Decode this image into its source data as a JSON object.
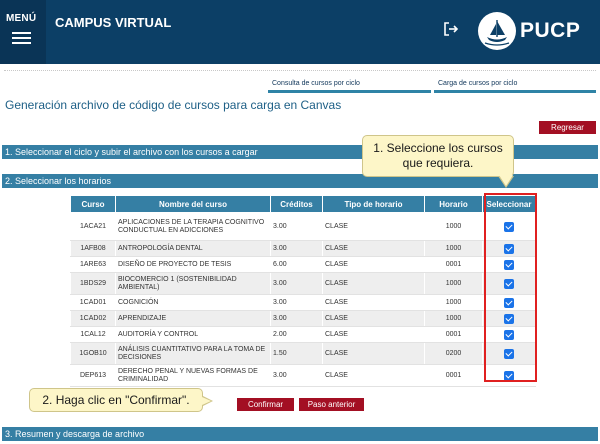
{
  "header": {
    "menu_label": "MENÚ",
    "app_title": "CAMPUS VIRTUAL",
    "logo_text": "PUCP",
    "brand_color": "#0c3f66"
  },
  "nav": {
    "consulta_label": "Consulta de cursos por ciclo",
    "carga_label": "Carga de cursos por ciclo"
  },
  "page": {
    "title": "Generación archivo de código de cursos para carga en Canvas",
    "regresar_label": "Regresar"
  },
  "sections": {
    "step1": "1. Seleccionar el ciclo y subir el archivo con los cursos a cargar",
    "step2": "2. Seleccionar los horarios",
    "step3": "3. Resumen y descarga de archivo"
  },
  "table": {
    "columns": [
      "Curso",
      "Nombre del curso",
      "Créditos",
      "Tipo de horario",
      "Horario",
      "Seleccionar"
    ],
    "rows": [
      {
        "code": "1ACA21",
        "name": "APLICACIONES DE LA TERAPIA COGNITIVO CONDUCTUAL EN ADICCIONES",
        "credits": "3.00",
        "type": "CLASE",
        "schedule": "1000",
        "selected": true
      },
      {
        "code": "1AFB08",
        "name": "ANTROPOLOGÍA DENTAL",
        "credits": "3.00",
        "type": "CLASE",
        "schedule": "1000",
        "selected": true
      },
      {
        "code": "1ARE63",
        "name": "DISEÑO DE PROYECTO DE TESIS",
        "credits": "6.00",
        "type": "CLASE",
        "schedule": "0001",
        "selected": true
      },
      {
        "code": "1BDS29",
        "name": "BIOCOMERCIO 1 (SOSTENIBILIDAD AMBIENTAL)",
        "credits": "3.00",
        "type": "CLASE",
        "schedule": "1000",
        "selected": true
      },
      {
        "code": "1CAD01",
        "name": "COGNICIÓN",
        "credits": "3.00",
        "type": "CLASE",
        "schedule": "1000",
        "selected": true
      },
      {
        "code": "1CAD02",
        "name": "APRENDIZAJE",
        "credits": "3.00",
        "type": "CLASE",
        "schedule": "1000",
        "selected": true
      },
      {
        "code": "1CAL12",
        "name": "AUDITORÍA Y CONTROL",
        "credits": "2.00",
        "type": "CLASE",
        "schedule": "0001",
        "selected": true
      },
      {
        "code": "1GOB10",
        "name": "ANÁLISIS CUANTITATIVO PARA LA TOMA DE DECISIONES",
        "credits": "1.50",
        "type": "CLASE",
        "schedule": "0200",
        "selected": true
      },
      {
        "code": "DEP613",
        "name": "DERECHO PENAL Y NUEVAS FORMAS DE CRIMINALIDAD",
        "credits": "3.00",
        "type": "CLASE",
        "schedule": "0001",
        "selected": true
      }
    ]
  },
  "callouts": {
    "first": "1. Seleccione los cursos que requiera.",
    "second": "2. Haga clic en \"Confirmar\"."
  },
  "actions": {
    "confirmar_label": "Confirmar",
    "paso_anterior_label": "Paso anterior"
  },
  "colors": {
    "section_bar": "#357fa4",
    "action_button": "#a30f23",
    "highlight": "#e02020",
    "callout_bg": "#fdf6c8"
  }
}
